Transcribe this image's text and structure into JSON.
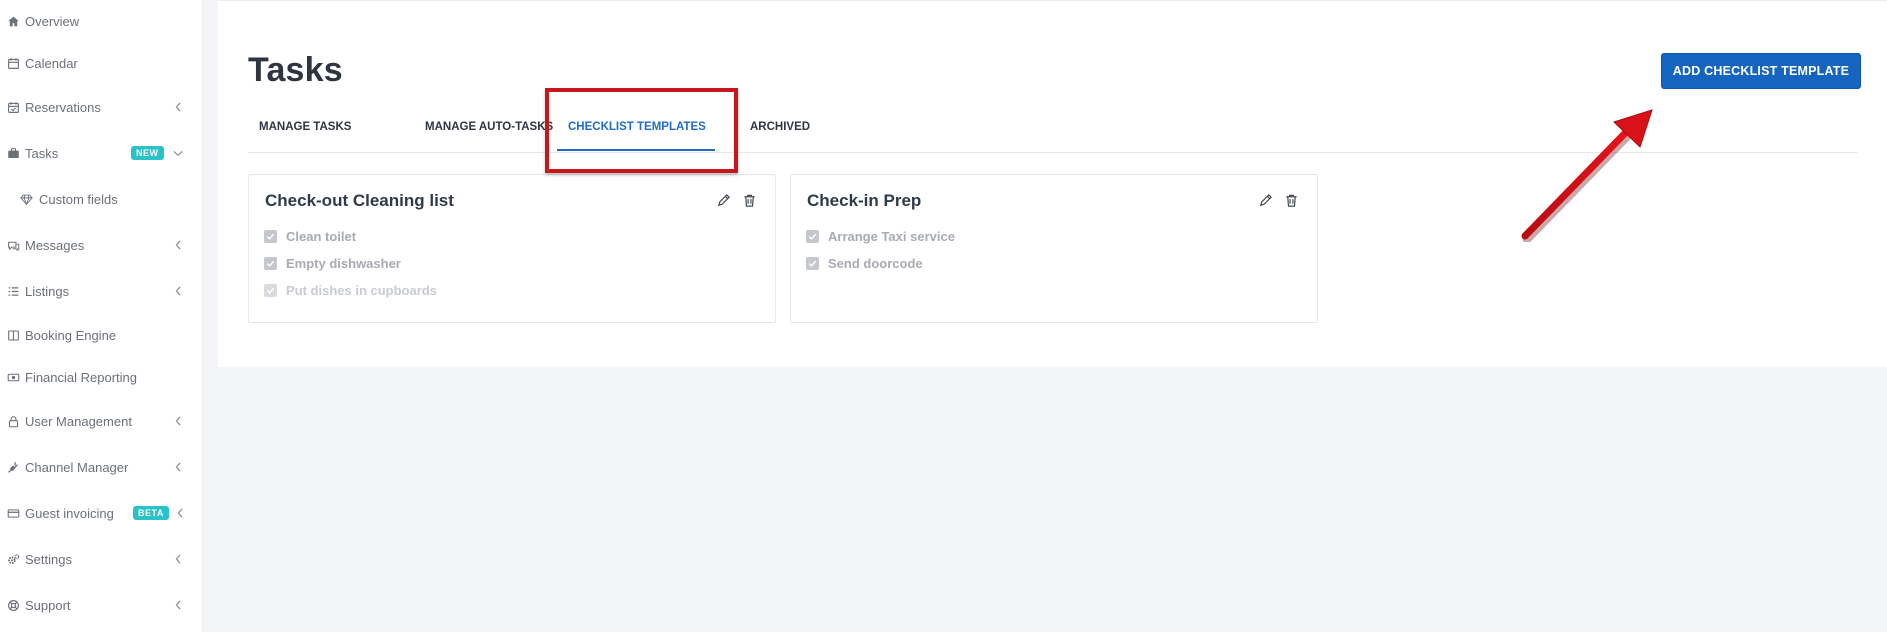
{
  "sidebar": {
    "items": [
      {
        "label": "Overview",
        "icon": "home-icon"
      },
      {
        "label": "Calendar",
        "icon": "calendar-icon"
      },
      {
        "label": "Reservations",
        "icon": "calendar-check-icon"
      },
      {
        "label": "Tasks",
        "icon": "briefcase-icon",
        "badge": "NEW"
      },
      {
        "label": "Custom fields",
        "icon": "diamond-icon"
      },
      {
        "label": "Messages",
        "icon": "chat-icon"
      },
      {
        "label": "Listings",
        "icon": "list-icon"
      },
      {
        "label": "Booking Engine",
        "icon": "book-icon"
      },
      {
        "label": "Financial Reporting",
        "icon": "money-icon"
      },
      {
        "label": "User Management",
        "icon": "lock-icon"
      },
      {
        "label": "Channel Manager",
        "icon": "plug-icon"
      },
      {
        "label": "Guest invoicing",
        "icon": "credit-card-icon",
        "badge": "BETA"
      },
      {
        "label": "Settings",
        "icon": "gears-icon"
      },
      {
        "label": "Support",
        "icon": "lifebuoy-icon"
      }
    ]
  },
  "page": {
    "title": "Tasks",
    "add_button": "ADD CHECKLIST TEMPLATE"
  },
  "tabs": [
    "MANAGE TASKS",
    "MANAGE AUTO-TASKS",
    "CHECKLIST TEMPLATES",
    "ARCHIVED"
  ],
  "active_tab": "CHECKLIST TEMPLATES",
  "cards": [
    {
      "title": "Check-out Cleaning list",
      "items": [
        "Clean toilet",
        "Empty dishwasher",
        "Put dishes in cupboards"
      ]
    },
    {
      "title": "Check-in Prep",
      "items": [
        "Arrange Taxi service",
        "Send doorcode"
      ]
    }
  ],
  "colors": {
    "accent": "#1565c0",
    "badge": "#2ac1c9",
    "annotation": "#d0131b"
  }
}
